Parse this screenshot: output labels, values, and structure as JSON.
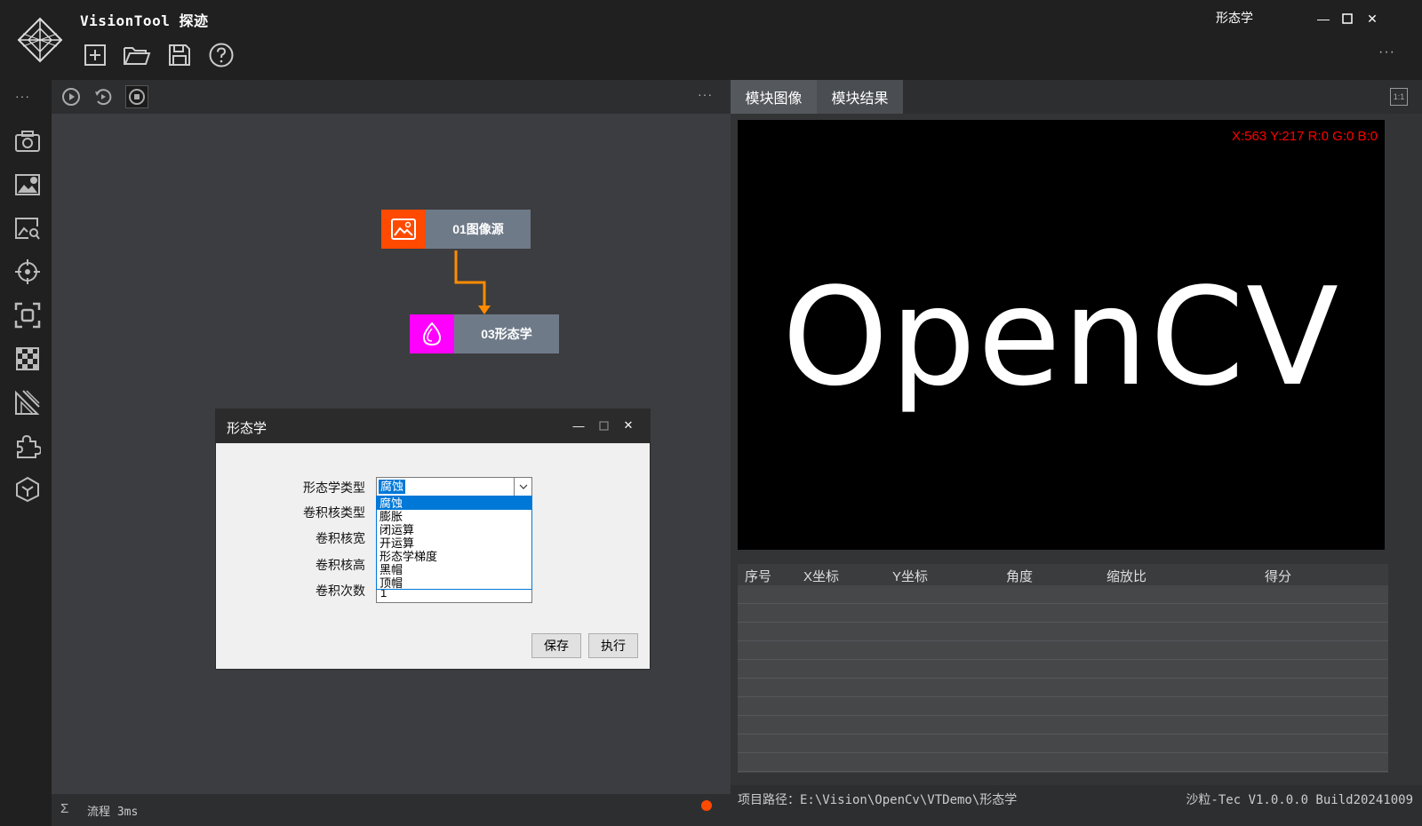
{
  "app": {
    "title": "VisionTool 探迹",
    "window_caption": "形态学",
    "titlebar_more": "···"
  },
  "toolbar": {
    "new_icon": "plus-square-icon",
    "open_icon": "folder-open-icon",
    "save_icon": "floppy-disk-icon",
    "help_icon": "help-circle-icon"
  },
  "sidebar": {
    "more": "···",
    "items": [
      "camera-icon",
      "image-settings-icon",
      "image-search-icon",
      "target-icon",
      "roi-focus-icon",
      "checker-pattern-icon",
      "measure-icon",
      "puzzle-icon",
      "cube-icon"
    ]
  },
  "flow": {
    "more": "···",
    "nodes": [
      {
        "label": "01图像源",
        "color": "#ff4a00"
      },
      {
        "label": "03形态学",
        "color": "#ff00ff"
      }
    ],
    "connector_color": "#ff8c00",
    "status_label": "流程",
    "status_time": "3ms"
  },
  "dialog": {
    "title": "形态学",
    "labels": {
      "morph_type": "形态学类型",
      "kernel_type": "卷积核类型",
      "kernel_width": "卷积核宽",
      "kernel_height": "卷积核高",
      "iterations": "卷积次数"
    },
    "morph_type_value": "腐蚀",
    "iterations_value": "1",
    "options": [
      "腐蚀",
      "膨胀",
      "闭运算",
      "开运算",
      "形态学梯度",
      "黑帽",
      "顶帽"
    ],
    "save_label": "保存",
    "run_label": "执行"
  },
  "right": {
    "tabs": [
      "模块图像",
      "模块结果"
    ],
    "ratio_label": "1:1",
    "pixel_readout": "X:563 Y:217  R:0 G:0 B:0",
    "image_text": "OpenCV",
    "table_headers": [
      "序号",
      "X坐标",
      "Y坐标",
      "角度",
      "缩放比",
      "得分"
    ],
    "project_path": "项目路径：E:\\Vision\\OpenCv\\VTDemo\\形态学",
    "version": "沙粒-Tec V1.0.0.0 Build20241009"
  },
  "colors": {
    "accent_orange": "#ff4a00",
    "accent_magenta": "#ff00ff",
    "selection_blue": "#0078d7",
    "readout_red": "#ff0000"
  }
}
